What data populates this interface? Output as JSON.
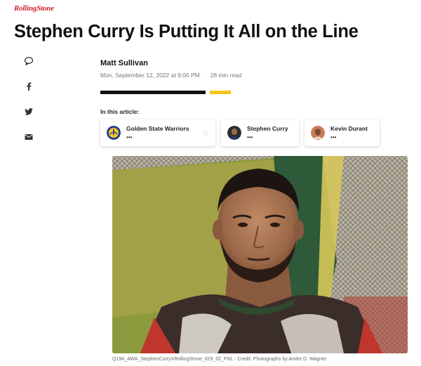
{
  "brand": {
    "logo": "RollingStone"
  },
  "article": {
    "title": "Stephen Curry Is Putting It All on the Line",
    "author": "Matt Sullivan",
    "date": "Mon, September 12, 2022 at 9:00 PM",
    "read_time": "28 min read",
    "in_article_label": "In this article:"
  },
  "entities": [
    {
      "name": "Golden State Warriors",
      "dots": "•••",
      "icon": "warriors-logo-icon",
      "star": "☆"
    },
    {
      "name": "Stephen Curry",
      "dots": "•••",
      "icon": "avatar"
    },
    {
      "name": "Kevin Durant",
      "dots": "•••",
      "icon": "avatar"
    }
  ],
  "share": [
    "comment-icon",
    "facebook-icon",
    "twitter-icon",
    "email-icon"
  ],
  "progress": {
    "read_fraction": 0.84
  },
  "image": {
    "caption": "Q194_AWA_StephenCurryXRollingStone_029_02_FNL - Credit: Photographs by Andre D. Wagner"
  },
  "colors": {
    "brand_red": "#d0202e",
    "progress_black": "#111111",
    "progress_yellow": "#f3c517"
  }
}
